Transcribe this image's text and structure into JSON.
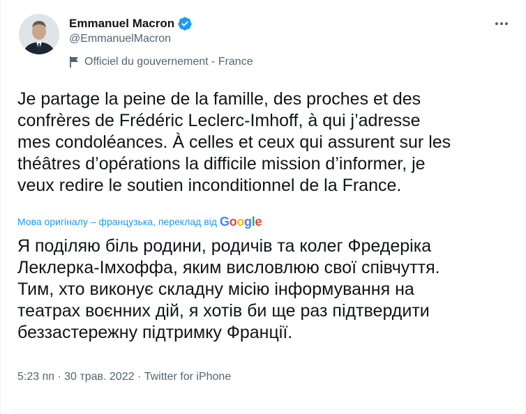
{
  "author": {
    "name": "Emmanuel Macron",
    "handle": "@EmmanuelMacron",
    "label": "Officiel du gouvernement - France",
    "verified_icon": "verified-badge-icon",
    "label_icon": "flag-icon",
    "accent_color": "#1d9bf0"
  },
  "menu": {
    "icon": "more-icon"
  },
  "tweet": {
    "original_lines": [
      "Je partage la peine de la famille, des proches et des",
      "confrères de Frédéric Leclerc-Imhoff, à qui j’adresse",
      "mes condoléances. À celles et ceux qui assurent sur les",
      "théâtres d’opérations la difficile mission d’informer, je",
      "veux redire le soutien inconditionnel de la France."
    ],
    "translation_note": "Мова оригіналу – французька, переклад від",
    "translation_provider": "Google",
    "translated_lines": [
      "Я поділяю біль родини, родичів та колег Фредеріка",
      "Леклерка-Імхоффа, яким висловлюю свої співчуття.",
      "Тим, хто виконує складну місію інформування на",
      "театрах воєнних дій, я хотів би ще раз підтвердити",
      "беззастережну підтримку Франції."
    ]
  },
  "meta": {
    "time": "5:23 пп",
    "separator": " · ",
    "date": "30 трав. 2022",
    "source": "Twitter for iPhone"
  }
}
